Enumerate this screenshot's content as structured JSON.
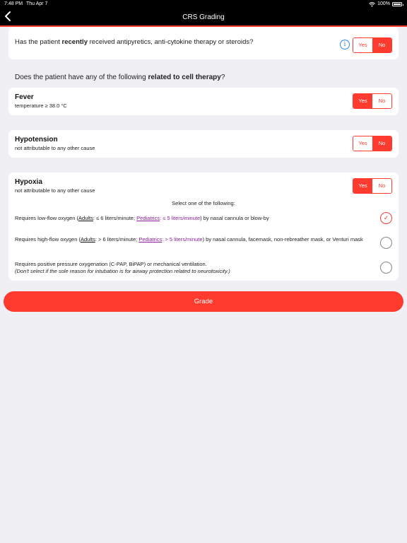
{
  "status_bar": {
    "time": "7:48 PM",
    "date": "Thu Apr 7",
    "battery": "100%"
  },
  "nav": {
    "back_icon": "chevron-left-icon",
    "title": "CRS Grading"
  },
  "recent_therapy": {
    "prefix": "Has the patient ",
    "bold": "recently",
    "suffix": " received antipyretics, anti-cytokine therapy or steroids?",
    "info_icon": "info-icon",
    "yes": "Yes",
    "no": "No",
    "selected": "No"
  },
  "section_heading": {
    "prefix": "Does the patient have any of the following ",
    "bold": "related to cell therapy",
    "suffix": "?"
  },
  "fever": {
    "title": "Fever",
    "subtitle": "temperature ≥ 38.0 °C",
    "yes": "Yes",
    "no": "No",
    "selected": "Yes"
  },
  "hypotension": {
    "title": "Hypotension",
    "subtitle": "not attributable to any other cause",
    "yes": "Yes",
    "no": "No",
    "selected": "No"
  },
  "hypoxia": {
    "title": "Hypoxia",
    "subtitle": "not attributable to any other cause",
    "yes": "Yes",
    "no": "No",
    "selected": "Yes",
    "select_label": "Select one of the following:",
    "options": [
      {
        "t1": "Requires low-flow oxygen (",
        "adults": "Adults",
        "t2": ": ≤ 6 liters/minute; ",
        "peds": "Pediatrics",
        "t3": ": ≤ 5 liters/minute",
        "t4": ") by nasal cannula or blow-by",
        "checked": true
      },
      {
        "t1": "Requires high-flow oxygen (",
        "adults": "Adults",
        "t2": ": > 6 liters/minute; ",
        "peds": "Pediatrics",
        "t3": ": > 5 liters/minute",
        "t4": ") by nasal cannula, facemask, non-rebreather mask, or Venturi mask",
        "checked": false
      },
      {
        "line1": "Requires positive pressure oxygenation (C-PAP, BiPAP) or mechanical ventilation.",
        "line2": "(Don't select if the sole reason for intubation is for airway protection related to neurotoxicity.)",
        "checked": false
      }
    ]
  },
  "grade_button": "Grade",
  "colors": {
    "accent": "#ff3b30",
    "info": "#2f89e0",
    "pediatrics": "#8a1f9a",
    "background": "#efeff4"
  }
}
